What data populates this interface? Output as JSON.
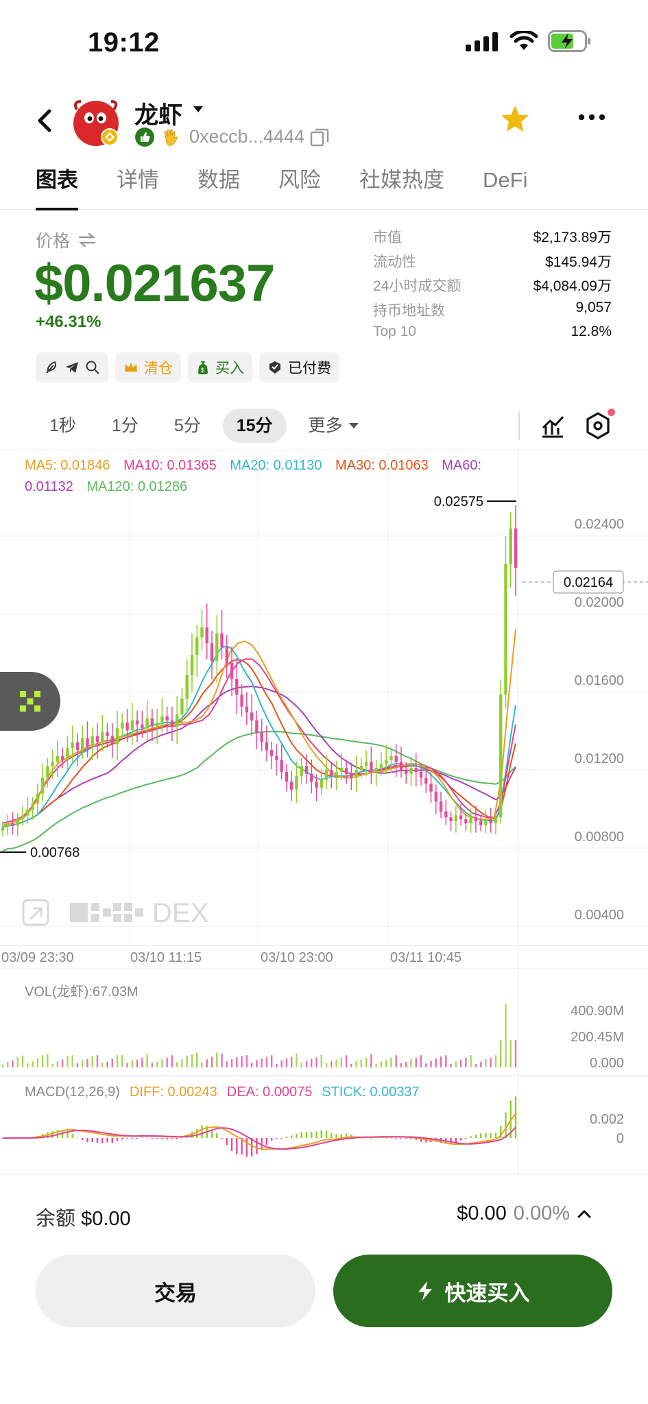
{
  "status_bar": {
    "time": "19:12"
  },
  "header": {
    "token_name": "龙虾",
    "address": "0xeccb...4444",
    "icons": [
      "back-arrow-icon",
      "caret-down-icon",
      "thumb-up-icon",
      "wave-hand-icon",
      "copy-icon",
      "star-icon",
      "more-dots-icon"
    ]
  },
  "tabs": [
    "图表",
    "详情",
    "数据",
    "风险",
    "社媒热度",
    "DeFi"
  ],
  "price_block": {
    "label": "价格",
    "price": "$0.021637",
    "change": "+46.31%"
  },
  "stats": [
    {
      "k": "市值",
      "v": "$2,173.89万"
    },
    {
      "k": "流动性",
      "v": "$145.94万"
    },
    {
      "k": "24小时成交额",
      "v": "$4,084.09万"
    },
    {
      "k": "持币地址数",
      "v": "9,057"
    },
    {
      "k": "Top 10",
      "v": "12.8%"
    }
  ],
  "chips": {
    "clear": "清仓",
    "buy": "买入",
    "paid": "已付费"
  },
  "intervals": [
    "1秒",
    "1分",
    "5分",
    "15分",
    "更多"
  ],
  "ma_legend": {
    "ma5": "MA5: 0.01846",
    "ma10": "MA10: 0.01365",
    "ma20": "MA20: 0.01130",
    "ma30": "MA30: 0.01063",
    "ma60": "MA60: 0.01132",
    "ma120": "MA120: 0.01286"
  },
  "colors": {
    "ma5": "#e5a020",
    "ma10": "#e0418f",
    "ma20": "#33b7d0",
    "ma30": "#e0541a",
    "ma60": "#a840b8",
    "ma120": "#5cb85c",
    "up": "#8fce2a",
    "down": "#e64c9c",
    "brand_green": "#2a7a1e"
  },
  "chart_data": {
    "type": "candlestick",
    "interval": "15分",
    "y_ticks": [
      "0.02400",
      "0.02000",
      "0.01600",
      "0.01200",
      "0.00800",
      "0.00400"
    ],
    "ylim": [
      0.0026,
      0.0272
    ],
    "x_ticks": [
      "03/09 23:30",
      "03/10 11:15",
      "03/10 23:00",
      "03/11 10:45"
    ],
    "high_label": "0.02575",
    "low_label": "0.00768",
    "current_price_label": "0.02164",
    "watermark": "DEX",
    "close_series": [
      0.0085,
      0.0087,
      0.0086,
      0.0089,
      0.0091,
      0.0094,
      0.0097,
      0.0102,
      0.011,
      0.0116,
      0.0118,
      0.0121,
      0.0119,
      0.0125,
      0.0128,
      0.0124,
      0.013,
      0.0126,
      0.0131,
      0.0128,
      0.0133,
      0.0131,
      0.0127,
      0.0135,
      0.0138,
      0.0134,
      0.0139,
      0.0137,
      0.0135,
      0.014,
      0.0136,
      0.0138,
      0.0141,
      0.0139,
      0.0136,
      0.0142,
      0.015,
      0.0162,
      0.0172,
      0.0181,
      0.0186,
      0.0178,
      0.0169,
      0.0183,
      0.0176,
      0.0168,
      0.016,
      0.0152,
      0.0146,
      0.0143,
      0.0139,
      0.0133,
      0.0128,
      0.0124,
      0.0121,
      0.0119,
      0.0113,
      0.0108,
      0.0104,
      0.0111,
      0.0116,
      0.0112,
      0.0108,
      0.0105,
      0.0109,
      0.0114,
      0.0111,
      0.0113,
      0.0115,
      0.0112,
      0.011,
      0.0114,
      0.0116,
      0.0118,
      0.0113,
      0.0115,
      0.0117,
      0.0119,
      0.0121,
      0.0118,
      0.0114,
      0.0112,
      0.0115,
      0.0113,
      0.011,
      0.0107,
      0.0103,
      0.0098,
      0.0093,
      0.009,
      0.0088,
      0.0091,
      0.0089,
      0.0087,
      0.009,
      0.0088,
      0.0086,
      0.0089,
      0.0087,
      0.009,
      0.0152,
      0.0218,
      0.0236,
      0.0216
    ],
    "ma5_series": [
      0.0086,
      0.0087,
      0.0088,
      0.009,
      0.0094,
      0.01,
      0.0108,
      0.0114,
      0.0118,
      0.012,
      0.0122,
      0.0124,
      0.0126,
      0.0127,
      0.0128,
      0.0129,
      0.013,
      0.0131,
      0.0132,
      0.0133,
      0.0134,
      0.0135,
      0.0136,
      0.0137,
      0.0137,
      0.0138,
      0.0138,
      0.0139,
      0.0141,
      0.0146,
      0.0154,
      0.0165,
      0.0174,
      0.0178,
      0.0179,
      0.0177,
      0.0172,
      0.0165,
      0.0158,
      0.0151,
      0.0145,
      0.0139,
      0.0132,
      0.0126,
      0.0121,
      0.0117,
      0.0113,
      0.0111,
      0.011,
      0.011,
      0.0111,
      0.0112,
      0.0113,
      0.0113,
      0.0114,
      0.0115,
      0.0116,
      0.0117,
      0.0117,
      0.0116,
      0.0114,
      0.0111,
      0.0106,
      0.01,
      0.0095,
      0.0091,
      0.009,
      0.0089,
      0.0089,
      0.009,
      0.011,
      0.015,
      0.0185
    ],
    "ma10_series": [
      0.0087,
      0.0088,
      0.0089,
      0.0091,
      0.0095,
      0.0101,
      0.0107,
      0.0112,
      0.0116,
      0.0119,
      0.0121,
      0.0123,
      0.0125,
      0.0126,
      0.0127,
      0.0128,
      0.0129,
      0.013,
      0.0131,
      0.0132,
      0.0133,
      0.0134,
      0.0135,
      0.0136,
      0.0136,
      0.0137,
      0.0137,
      0.0138,
      0.0139,
      0.0142,
      0.0148,
      0.0156,
      0.0163,
      0.0168,
      0.017,
      0.017,
      0.0167,
      0.0162,
      0.0156,
      0.015,
      0.0144,
      0.0139,
      0.0134,
      0.0129,
      0.0125,
      0.0121,
      0.0118,
      0.0115,
      0.0113,
      0.0112,
      0.0112,
      0.0112,
      0.0113,
      0.0114,
      0.0115,
      0.0116,
      0.0116,
      0.0117,
      0.0117,
      0.0116,
      0.0115,
      0.0113,
      0.0109,
      0.0104,
      0.0099,
      0.0095,
      0.0092,
      0.0091,
      0.009,
      0.009,
      0.0098,
      0.0118,
      0.0137
    ]
  },
  "volume": {
    "label": "VOL(龙虾):67.03M",
    "y_ticks": [
      "400.90M",
      "200.45M",
      "0.000"
    ]
  },
  "macd": {
    "label": "MACD(12,26,9)",
    "diff": "DIFF: 0.00243",
    "dea": "DEA: 0.00075",
    "stick": "STICK: 0.00337",
    "y_ticks": [
      "0.002",
      "0"
    ]
  },
  "bottom": {
    "balance_label": "余额",
    "balance_value": "$0.00",
    "pnl_value": "$0.00",
    "pnl_pct": "0.00%",
    "trade_label": "交易",
    "buy_label": "快速买入"
  }
}
